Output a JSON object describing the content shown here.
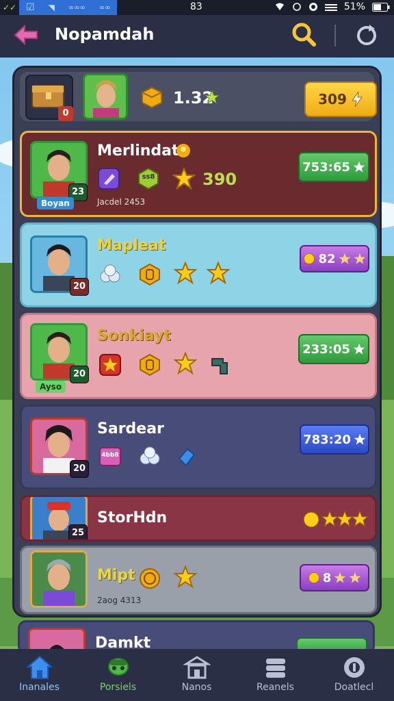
{
  "status_bar": {
    "left_items": [
      "✓✓",
      "☑",
      "◥",
      "∞∞∞",
      "∞∞"
    ],
    "time": "83",
    "battery": "51%"
  },
  "header": {
    "title": "Nopamdah"
  },
  "top_row": {
    "chest_badge": "0",
    "score": "1.32",
    "button_label": "309"
  },
  "cards": [
    {
      "name": "Merlindat",
      "sub": "Jacdel 2453",
      "plate": "Boyan",
      "level": "23",
      "stat": "390",
      "gem_label": "ss8",
      "score": "753:65"
    },
    {
      "name": "Mapleat",
      "level": "20",
      "score": "82"
    },
    {
      "name": "Sonkiayt",
      "plate": "Ayso",
      "level": "20",
      "score": "233:05"
    },
    {
      "name": "Sardear",
      "level": "20",
      "gem_label": "4bb8",
      "score": "783:20"
    },
    {
      "name": "StorHdn",
      "level": "25"
    },
    {
      "name": "Mipt",
      "sub": "2aog 4313",
      "score": "8"
    },
    {
      "name": "Damkt"
    }
  ],
  "tabs": [
    {
      "label": "Inanales",
      "icon": "home-icon"
    },
    {
      "label": "Porsiels",
      "icon": "character-icon"
    },
    {
      "label": "Nanos",
      "icon": "building-icon"
    },
    {
      "label": "Reanels",
      "icon": "stack-icon"
    },
    {
      "label": "Doatlecl",
      "icon": "coin-icon"
    }
  ],
  "colors": {
    "header_bg": "#2a2f45",
    "panel_bg": "#3a3f55",
    "accent_yellow": "#f0ab12",
    "accent_green": "#2e9a3c",
    "accent_blue": "#2c49c6",
    "accent_purple": "#8b3fc0"
  }
}
